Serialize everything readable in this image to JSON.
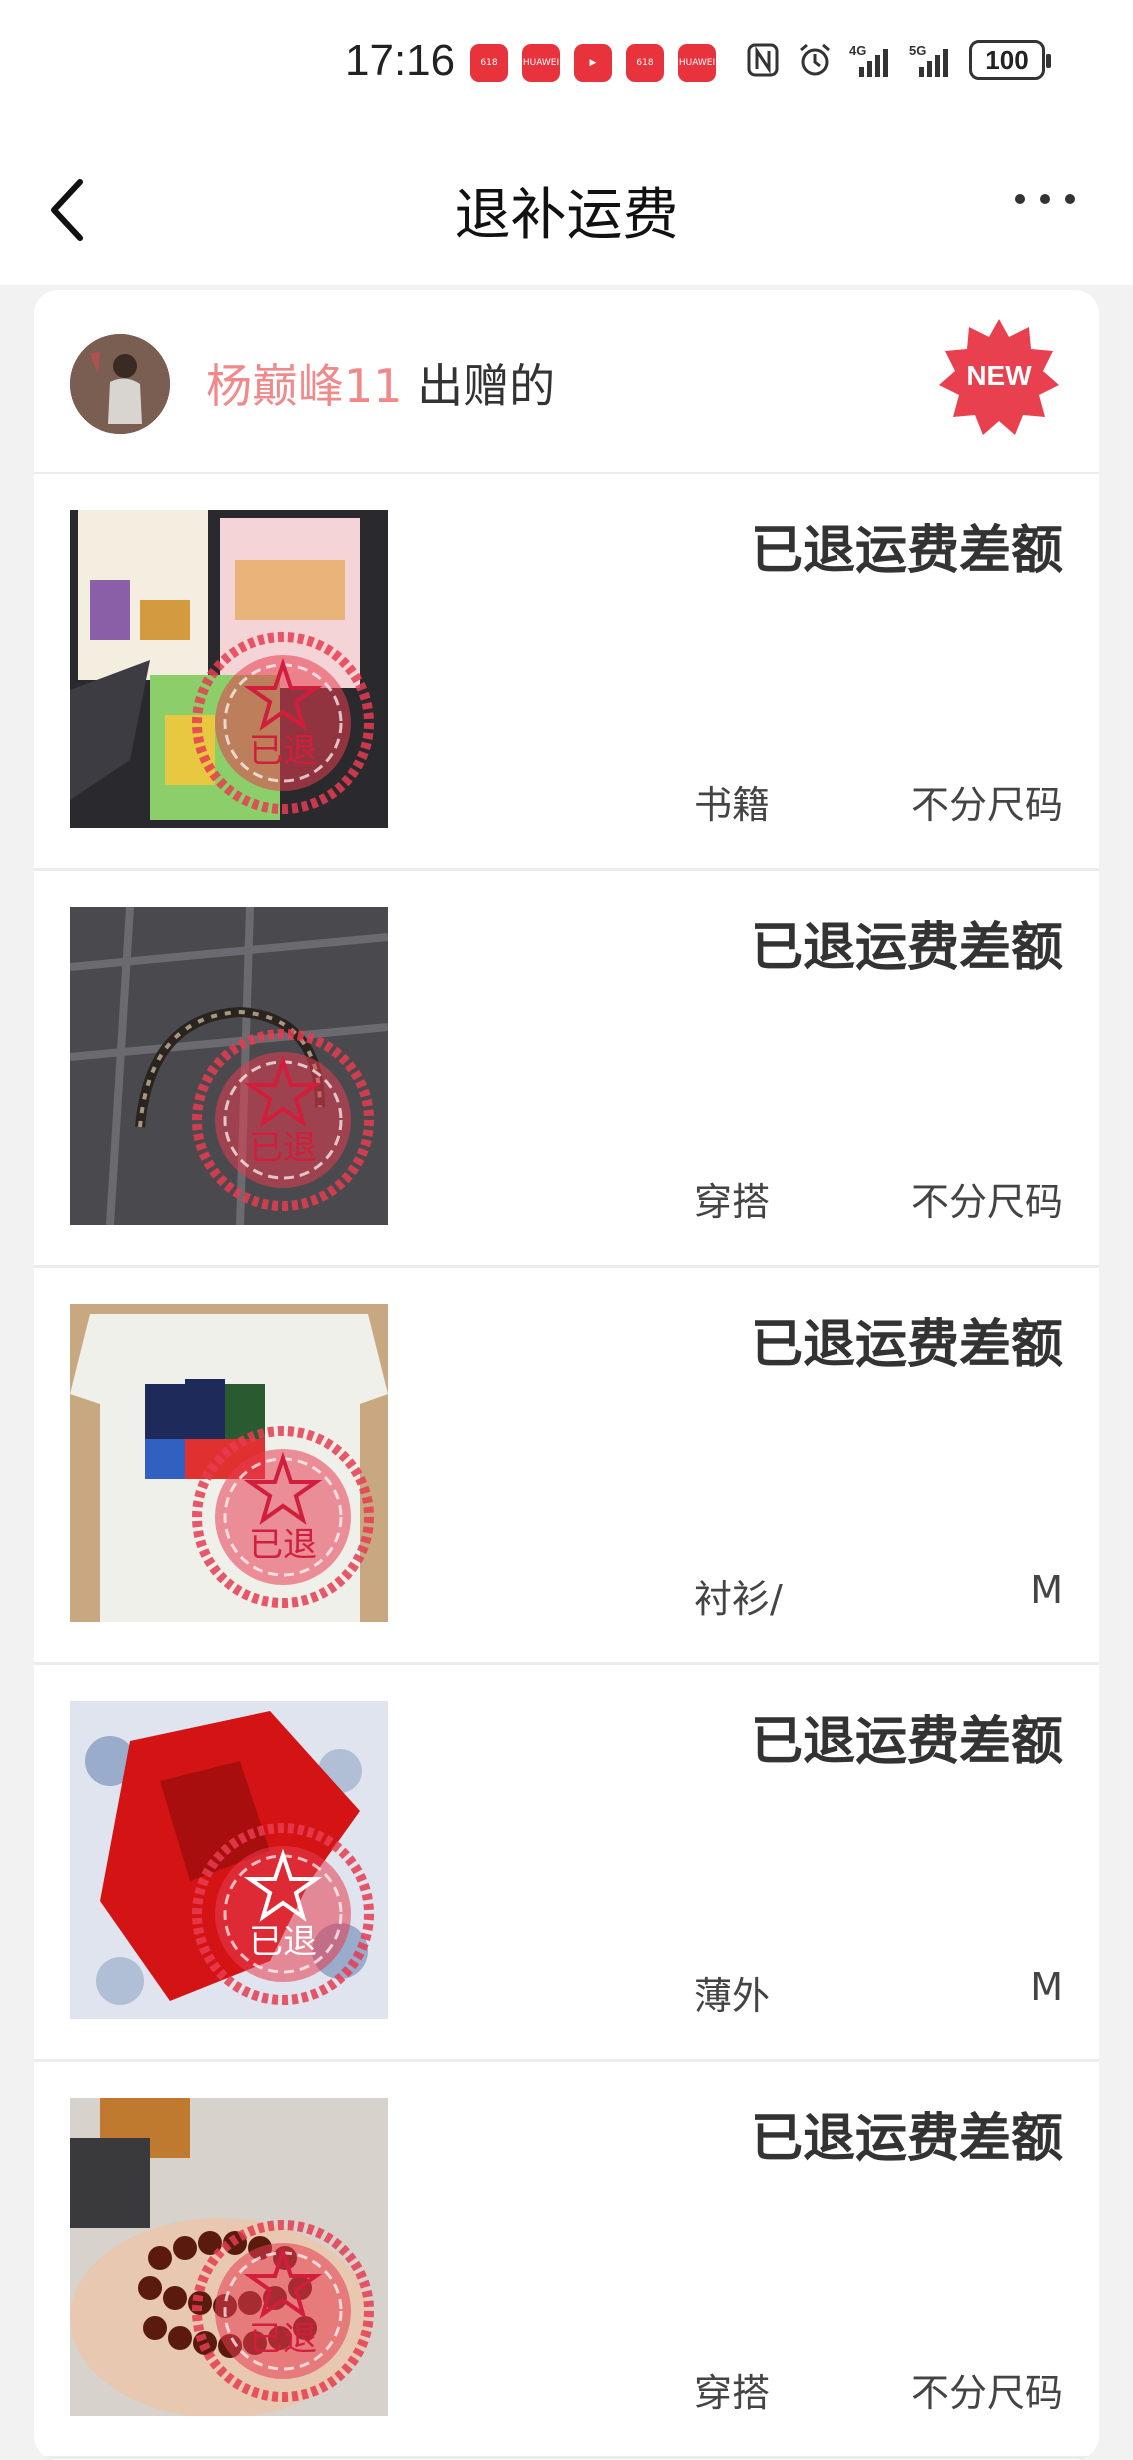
{
  "status_bar": {
    "time": "17:16",
    "app_icons": [
      {
        "name": "618-promo-app-icon",
        "label": "618"
      },
      {
        "name": "huawei-store-app-icon",
        "label": "HUAWEI"
      },
      {
        "name": "video-app-icon",
        "label": "▶"
      },
      {
        "name": "618-shopping-app-icon",
        "label": "618"
      },
      {
        "name": "huawei-mall-app-icon",
        "label": "HUAWEI"
      }
    ],
    "network_1": "4G",
    "network_2": "5G",
    "battery": "100"
  },
  "navbar": {
    "title": "退补运费"
  },
  "sender": {
    "name": "杨巅峰11",
    "suffix": "出赠的",
    "badge": "NEW"
  },
  "stamp_text": "已退",
  "items": [
    {
      "status": "已退运费差额",
      "category": "书籍",
      "size": "不分尺码",
      "thumb": "books"
    },
    {
      "status": "已退运费差额",
      "category": "穿搭",
      "size": "不分尺码",
      "thumb": "headband"
    },
    {
      "status": "已退运费差额",
      "category": "衬衫/",
      "size": "M",
      "thumb": "tshirt"
    },
    {
      "status": "已退运费差额",
      "category": "薄外",
      "size": "M",
      "thumb": "red-jacket"
    },
    {
      "status": "已退运费差额",
      "category": "穿搭",
      "size": "不分尺码",
      "thumb": "beads"
    }
  ],
  "colors": {
    "accent_red": "#e8323c",
    "sender_name": "#f08a8a",
    "stamp": "#e63c50"
  }
}
